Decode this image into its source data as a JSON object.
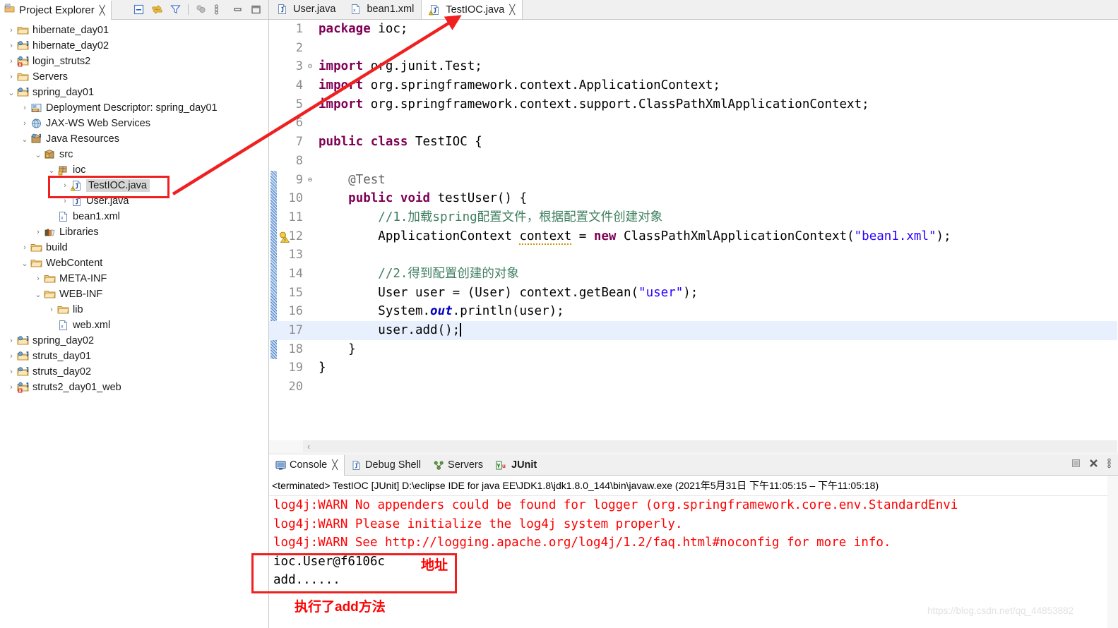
{
  "explorer": {
    "title": "Project Explorer",
    "close_glyph": "╳",
    "toolbar": [
      {
        "name": "collapse-all-icon"
      },
      {
        "name": "link-with-editor-icon"
      },
      {
        "name": "filter-icon"
      },
      {
        "name": "focus-active-task-icon"
      },
      {
        "name": "view-menu-icon"
      },
      {
        "name": "minimize-icon"
      },
      {
        "name": "maximize-icon"
      }
    ],
    "tree": [
      {
        "label": "hibernate_day01",
        "indent": 0,
        "twisty": "›",
        "icon": "project-closed-icon",
        "selected": false
      },
      {
        "label": "hibernate_day02",
        "indent": 0,
        "twisty": "›",
        "icon": "project-java-icon",
        "selected": false
      },
      {
        "label": "login_struts2",
        "indent": 0,
        "twisty": "›",
        "icon": "project-error-icon",
        "selected": false
      },
      {
        "label": "Servers",
        "indent": 0,
        "twisty": "›",
        "icon": "folder-icon",
        "selected": false
      },
      {
        "label": "spring_day01",
        "indent": 0,
        "twisty": "⌄",
        "icon": "project-java-icon",
        "selected": false
      },
      {
        "label": "Deployment Descriptor: spring_day01",
        "indent": 1,
        "twisty": "›",
        "icon": "deployment-descriptor-icon",
        "selected": false
      },
      {
        "label": "JAX-WS Web Services",
        "indent": 1,
        "twisty": "›",
        "icon": "webservice-icon",
        "selected": false
      },
      {
        "label": "Java Resources",
        "indent": 1,
        "twisty": "⌄",
        "icon": "java-resources-icon",
        "selected": false
      },
      {
        "label": "src",
        "indent": 2,
        "twisty": "⌄",
        "icon": "source-folder-icon",
        "selected": false
      },
      {
        "label": "ioc",
        "indent": 3,
        "twisty": "⌄",
        "icon": "package-icon",
        "selected": false
      },
      {
        "label": "TestIOC.java",
        "indent": 4,
        "twisty": "›",
        "icon": "java-file-warning-icon",
        "selected": true
      },
      {
        "label": "User.java",
        "indent": 4,
        "twisty": "›",
        "icon": "java-file-icon",
        "selected": false
      },
      {
        "label": "bean1.xml",
        "indent": 3,
        "twisty": "",
        "icon": "xml-file-icon",
        "selected": false
      },
      {
        "label": "Libraries",
        "indent": 2,
        "twisty": "›",
        "icon": "libraries-icon",
        "selected": false
      },
      {
        "label": "build",
        "indent": 1,
        "twisty": "›",
        "icon": "folder-icon",
        "selected": false
      },
      {
        "label": "WebContent",
        "indent": 1,
        "twisty": "⌄",
        "icon": "folder-icon",
        "selected": false
      },
      {
        "label": "META-INF",
        "indent": 2,
        "twisty": "›",
        "icon": "folder-icon",
        "selected": false
      },
      {
        "label": "WEB-INF",
        "indent": 2,
        "twisty": "⌄",
        "icon": "folder-icon",
        "selected": false
      },
      {
        "label": "lib",
        "indent": 3,
        "twisty": "›",
        "icon": "folder-icon",
        "selected": false
      },
      {
        "label": "web.xml",
        "indent": 3,
        "twisty": "",
        "icon": "xml-file-icon",
        "selected": false
      },
      {
        "label": "spring_day02",
        "indent": 0,
        "twisty": "›",
        "icon": "project-java-icon",
        "selected": false
      },
      {
        "label": "struts_day01",
        "indent": 0,
        "twisty": "›",
        "icon": "project-java-icon",
        "selected": false
      },
      {
        "label": "struts_day02",
        "indent": 0,
        "twisty": "›",
        "icon": "project-java-icon",
        "selected": false
      },
      {
        "label": "struts2_day01_web",
        "indent": 0,
        "twisty": "›",
        "icon": "project-error-icon",
        "selected": false
      }
    ]
  },
  "editor": {
    "tabs": [
      {
        "label": "User.java",
        "icon": "java-file-icon",
        "active": false,
        "closable": false
      },
      {
        "label": "bean1.xml",
        "icon": "xml-file-icon",
        "active": false,
        "closable": false
      },
      {
        "label": "TestIOC.java",
        "icon": "java-file-warning-icon",
        "active": true,
        "closable": true,
        "close_glyph": "╳"
      }
    ],
    "lines": [
      {
        "no": "1",
        "fold": "",
        "highlight": false,
        "marker": "",
        "tokens": [
          {
            "t": "package",
            "c": "kw"
          },
          {
            "t": " ioc;",
            "c": "plain"
          }
        ]
      },
      {
        "no": "2",
        "fold": "",
        "highlight": false,
        "marker": "",
        "tokens": []
      },
      {
        "no": "3",
        "fold": "⊖",
        "highlight": false,
        "marker": "",
        "tokens": [
          {
            "t": "import",
            "c": "kw"
          },
          {
            "t": " org.junit.Test;",
            "c": "plain"
          }
        ]
      },
      {
        "no": "4",
        "fold": "",
        "highlight": false,
        "marker": "",
        "tokens": [
          {
            "t": "import",
            "c": "kw"
          },
          {
            "t": " org.springframework.context.ApplicationContext;",
            "c": "plain"
          }
        ]
      },
      {
        "no": "5",
        "fold": "",
        "highlight": false,
        "marker": "",
        "tokens": [
          {
            "t": "import",
            "c": "kw"
          },
          {
            "t": " org.springframework.context.support.ClassPathXmlApplicationContext;",
            "c": "plain"
          }
        ]
      },
      {
        "no": "6",
        "fold": "",
        "highlight": false,
        "marker": "",
        "tokens": []
      },
      {
        "no": "7",
        "fold": "",
        "highlight": false,
        "marker": "",
        "tokens": [
          {
            "t": "public",
            "c": "kw"
          },
          {
            "t": " ",
            "c": "plain"
          },
          {
            "t": "class",
            "c": "kw"
          },
          {
            "t": " TestIOC {",
            "c": "plain"
          }
        ]
      },
      {
        "no": "8",
        "fold": "",
        "highlight": false,
        "marker": "",
        "tokens": []
      },
      {
        "no": "9",
        "fold": "⊖",
        "highlight": false,
        "marker": "",
        "tokens": [
          {
            "t": "    @Test",
            "c": "ann"
          }
        ]
      },
      {
        "no": "10",
        "fold": "",
        "highlight": false,
        "marker": "",
        "tokens": [
          {
            "t": "    ",
            "c": "plain"
          },
          {
            "t": "public",
            "c": "kw"
          },
          {
            "t": " ",
            "c": "plain"
          },
          {
            "t": "void",
            "c": "kw"
          },
          {
            "t": " testUser() {",
            "c": "plain"
          }
        ]
      },
      {
        "no": "11",
        "fold": "",
        "highlight": false,
        "marker": "",
        "tokens": [
          {
            "t": "        //1.加载spring配置文件，根据配置文件创建对象",
            "c": "cmt"
          }
        ]
      },
      {
        "no": "12",
        "fold": "",
        "highlight": false,
        "marker": "warning",
        "tokens": [
          {
            "t": "        ApplicationContext ",
            "c": "plain"
          },
          {
            "t": "context",
            "c": "warnsq"
          },
          {
            "t": " = ",
            "c": "plain"
          },
          {
            "t": "new",
            "c": "kw"
          },
          {
            "t": " ClassPathXmlApplicationContext(",
            "c": "plain"
          },
          {
            "t": "\"bean1.xml\"",
            "c": "str"
          },
          {
            "t": ");",
            "c": "plain"
          }
        ]
      },
      {
        "no": "13",
        "fold": "",
        "highlight": false,
        "marker": "",
        "tokens": []
      },
      {
        "no": "14",
        "fold": "",
        "highlight": false,
        "marker": "",
        "tokens": [
          {
            "t": "        //2.得到配置创建的对象",
            "c": "cmt"
          }
        ]
      },
      {
        "no": "15",
        "fold": "",
        "highlight": false,
        "marker": "",
        "tokens": [
          {
            "t": "        User user = (User) context.getBean(",
            "c": "plain"
          },
          {
            "t": "\"user\"",
            "c": "str"
          },
          {
            "t": ");",
            "c": "plain"
          }
        ]
      },
      {
        "no": "16",
        "fold": "",
        "highlight": false,
        "marker": "",
        "tokens": [
          {
            "t": "        System.",
            "c": "plain"
          },
          {
            "t": "out",
            "c": "fieldi"
          },
          {
            "t": ".println(user);",
            "c": "plain"
          }
        ]
      },
      {
        "no": "17",
        "fold": "",
        "highlight": true,
        "marker": "",
        "tokens": [
          {
            "t": "        user.add();",
            "c": "plain"
          }
        ]
      },
      {
        "no": "18",
        "fold": "",
        "highlight": false,
        "marker": "",
        "tokens": [
          {
            "t": "    }",
            "c": "plain"
          }
        ]
      },
      {
        "no": "19",
        "fold": "",
        "highlight": false,
        "marker": "",
        "tokens": [
          {
            "t": "}",
            "c": "plain"
          }
        ]
      },
      {
        "no": "20",
        "fold": "",
        "highlight": false,
        "marker": "",
        "tokens": []
      }
    ],
    "hscroll_arrow": "‹"
  },
  "console": {
    "tabs": [
      {
        "label": "Console",
        "icon": "console-icon",
        "active": true,
        "bold": false,
        "closable": true,
        "close_glyph": "╳"
      },
      {
        "label": "Debug Shell",
        "icon": "debug-shell-icon",
        "active": false,
        "bold": false,
        "closable": false
      },
      {
        "label": "Servers",
        "icon": "servers-icon",
        "active": false,
        "bold": false,
        "closable": false
      },
      {
        "label": "JUnit",
        "icon": "junit-icon",
        "active": false,
        "bold": true,
        "closable": false
      }
    ],
    "toolbar": [
      {
        "name": "terminate-icon"
      },
      {
        "name": "close-console-icon"
      },
      {
        "name": "view-menu-icon"
      }
    ],
    "terminated_line": "<terminated> TestIOC [JUnit] D:\\eclipse IDE for java EE\\JDK1.8\\jdk1.8.0_144\\bin\\javaw.exe  (2021年5月31日 下午11:05:15 – 下午11:05:18)",
    "output": [
      {
        "text": "log4j:WARN No appenders could be found for logger (org.springframework.core.env.StandardEnvi",
        "stream": "err"
      },
      {
        "text": "log4j:WARN Please initialize the log4j system properly.",
        "stream": "err"
      },
      {
        "text": "log4j:WARN See http://logging.apache.org/log4j/1.2/faq.html#noconfig for more info.",
        "stream": "err"
      },
      {
        "text": "ioc.User@f6106c",
        "stream": "std"
      },
      {
        "text": "add......",
        "stream": "std"
      }
    ]
  },
  "annotations": {
    "arrow_label": "red-arrow-pointing-to-testioc-tab",
    "box_tree_label": "red-box-around-testioc-java-tree-node",
    "box_console_label": "red-box-around-console-output",
    "dizhi": "地址",
    "add_method": "执行了add方法"
  },
  "watermark": "https://blog.csdn.net/qq_44853882"
}
